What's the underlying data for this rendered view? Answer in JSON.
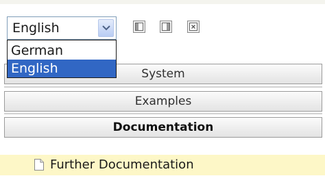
{
  "language_selector": {
    "selected": "English",
    "options": [
      "German",
      "English"
    ],
    "highlighted_option": "English"
  },
  "toolbar": {
    "buttons": [
      {
        "icon": "panel-left-icon"
      },
      {
        "icon": "panel-right-icon"
      },
      {
        "icon": "close-icon"
      }
    ]
  },
  "nav": {
    "items": [
      "System",
      "Examples",
      "Documentation"
    ],
    "active": "Documentation"
  },
  "doc_tree": {
    "items": [
      {
        "label": "Further Documentation",
        "icon": "document-icon"
      }
    ]
  },
  "colors": {
    "highlight_row": "#fdf7c7",
    "selected_option": "#3167c4"
  }
}
